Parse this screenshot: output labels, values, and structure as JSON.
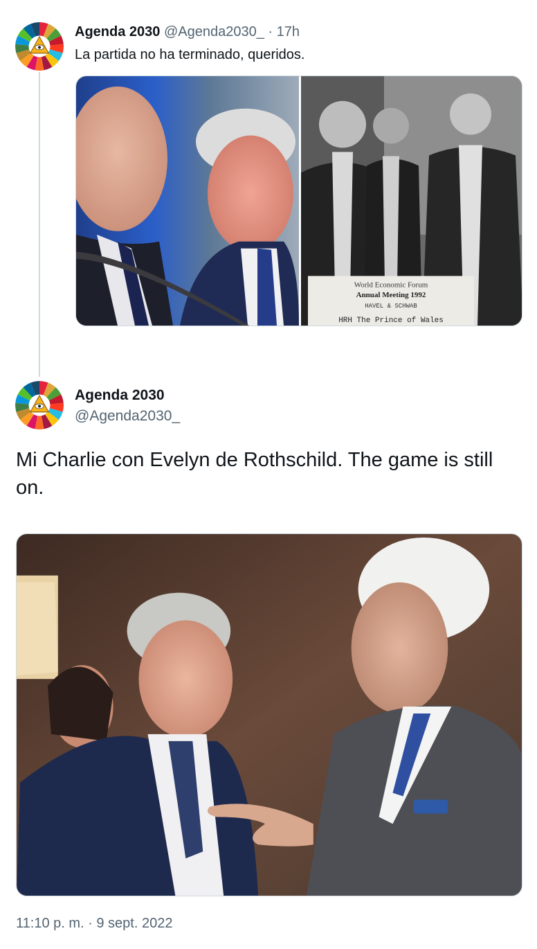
{
  "reply_tweet": {
    "author": {
      "display_name": "Agenda 2030",
      "handle": "@Agenda2030_",
      "avatar_icon": "sdg-wheel-eye-icon"
    },
    "separator": "·",
    "time_ago": "17h",
    "text": "La partida no ha terminado, queridos.",
    "media": [
      {
        "icon": "photo-two-men-talking"
      },
      {
        "icon": "photo-black-white-group",
        "placard": [
          "World Economic Forum",
          "Annual Meeting 1992",
          "HAVEL & SCHWAB",
          "HRH The Prince of Wales"
        ]
      }
    ]
  },
  "main_tweet": {
    "author": {
      "display_name": "Agenda 2030",
      "handle": "@Agenda2030_",
      "avatar_icon": "sdg-wheel-eye-icon"
    },
    "text": "Mi Charlie con Evelyn de Rothschild. The game is still on.",
    "media": {
      "icon": "photo-two-men-pointing"
    },
    "timestamp": "11:10 p. m. · 9 sept. 2022"
  },
  "colors": {
    "text_primary": "#0f1419",
    "text_secondary": "#536471",
    "border": "#cfd9de",
    "sdg_segments": [
      "#e5243b",
      "#dda63a",
      "#4c9f38",
      "#c5192d",
      "#ff3a21",
      "#26bde2",
      "#fcc30b",
      "#a21942",
      "#fd6925",
      "#dd1367",
      "#fd9d24",
      "#bf8b2e",
      "#3f7e44",
      "#0a97d9",
      "#56c02b",
      "#00689d",
      "#19486a"
    ]
  }
}
